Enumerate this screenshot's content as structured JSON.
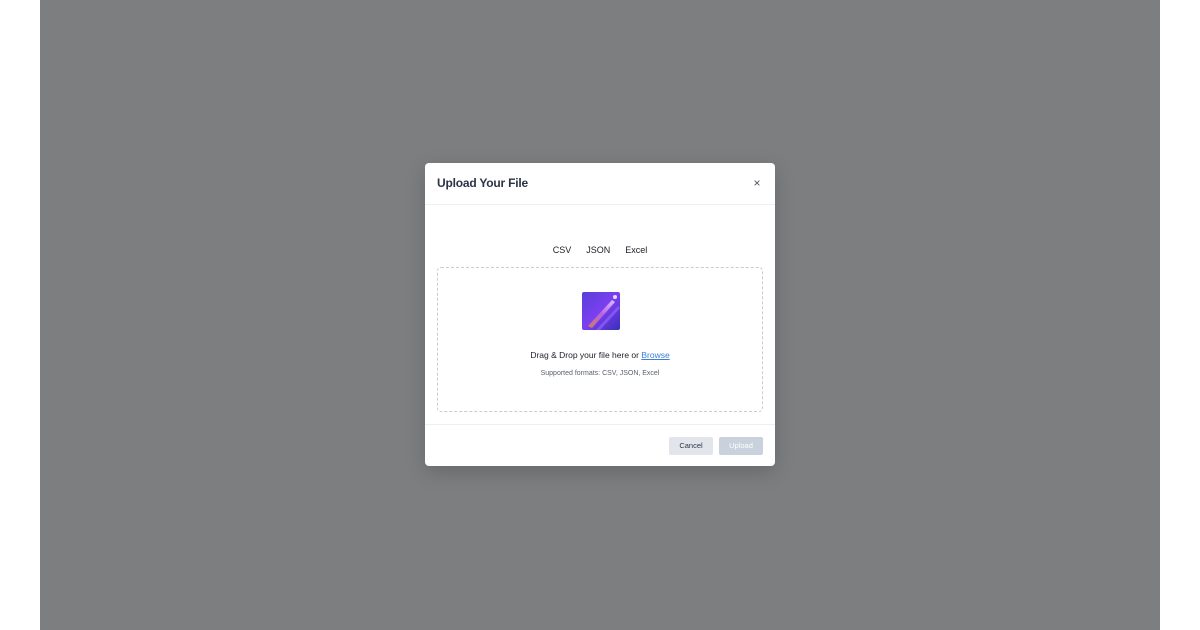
{
  "modal": {
    "title": "Upload Your File",
    "close_glyph": "×",
    "close_icon": "close-icon"
  },
  "format_tabs": [
    "CSV",
    "JSON",
    "Excel"
  ],
  "dropzone": {
    "thumbnail_icon": "image-thumbnail-icon",
    "drag_text": "Drag & Drop your file here or ",
    "browse_label": "Browse",
    "supported_text": "Supported formats: CSV, JSON, Excel"
  },
  "footer": {
    "cancel_label": "Cancel",
    "upload_label": "Upload"
  },
  "colors": {
    "overlay": "#7d7e80",
    "link": "#3b7fd6",
    "upload_disabled": "#c9d1dc",
    "cancel_bg": "#e2e6ec"
  }
}
